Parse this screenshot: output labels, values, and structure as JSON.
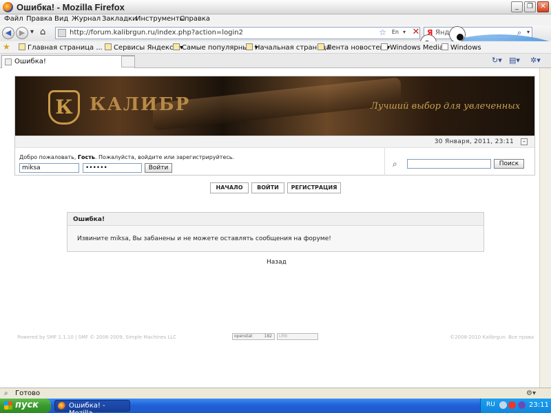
{
  "window": {
    "title": "Ошибка! - Mozilla Firefox",
    "buttons": {
      "minimize": "_",
      "maximize": "❐",
      "close": "✕"
    }
  },
  "menu": [
    "Файл",
    "Правка",
    "Вид",
    "Журнал",
    "Закладки",
    "Инструменты",
    "Справка"
  ],
  "nav": {
    "url": "http://forum.kalibrgun.ru/index.php?action=login2",
    "lang_badge": "En",
    "search_provider": "Я",
    "search_placeholder": "Яндекс"
  },
  "bookmarks": [
    "Главная страница ...",
    "Сервисы Яндекса",
    "Самые популярные",
    "Начальная страница",
    "Лента новостей",
    "Windows Media",
    "Windows"
  ],
  "tab": {
    "title": "Ошибка!"
  },
  "forum": {
    "brand": "КАЛИБР",
    "logo_letter": "К",
    "slogan": "Лучший выбор для увлеченных",
    "date": "30 Января, 2011, 23:11",
    "welcome_prefix": "Добро пожаловать, ",
    "welcome_guest": "Гость",
    "welcome_suffix": ". Пожалуйста, войдите или зарегистрируйтесь.",
    "username": "miksa",
    "password": "••••••",
    "login_button": "Войти",
    "search_button": "Поиск",
    "nav_links": [
      "НАЧАЛО",
      "ВОЙТИ",
      "РЕГИСТРАЦИЯ"
    ],
    "error_title": "Ошибка!",
    "error_message": "Извините miksa, Вы забанены и не можете оставлять сообщения на форуме!",
    "back_link": "Назад",
    "footer_left": "Powered by SMF 1.1.10 | SMF © 2006-2009, Simple Machines LLC",
    "footer_right": "©2008-2010 Kalibrgun. Все права",
    "counter_label": "openstat",
    "counter_value": "182",
    "counter2_label": "LRN"
  },
  "status": {
    "text": "Готово"
  },
  "taskbar": {
    "start": "пуск",
    "item": "Ошибка! - Mozilla...",
    "lang": "RU",
    "clock": "23:11"
  },
  "colors": {
    "accent_gold": "#C99A48",
    "taskbar_blue": "#2161D8",
    "start_green": "#3A9A2E"
  }
}
